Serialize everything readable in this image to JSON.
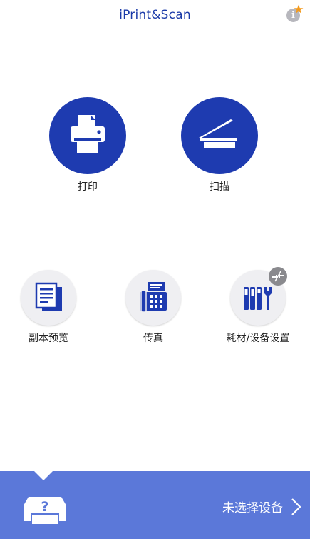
{
  "header": {
    "title": "iPrint&Scan"
  },
  "main": {
    "print_label": "打印",
    "scan_label": "扫描",
    "copy_preview_label": "副本预览",
    "fax_label": "传真",
    "supplies_settings_label": "耗材/设备设置"
  },
  "footer": {
    "device_status": "未选择设备"
  },
  "colors": {
    "brand_blue": "#1e3bb0",
    "title_blue": "#1a3aa8",
    "footer_blue": "#5b78d9",
    "star_orange": "#f39a1d"
  },
  "icons": [
    "info-icon",
    "star-icon",
    "printer-icon",
    "scanner-icon",
    "copy-preview-icon",
    "fax-icon",
    "supplies-tools-icon",
    "disconnected-icon",
    "unknown-printer-icon",
    "chevron-right-icon"
  ]
}
